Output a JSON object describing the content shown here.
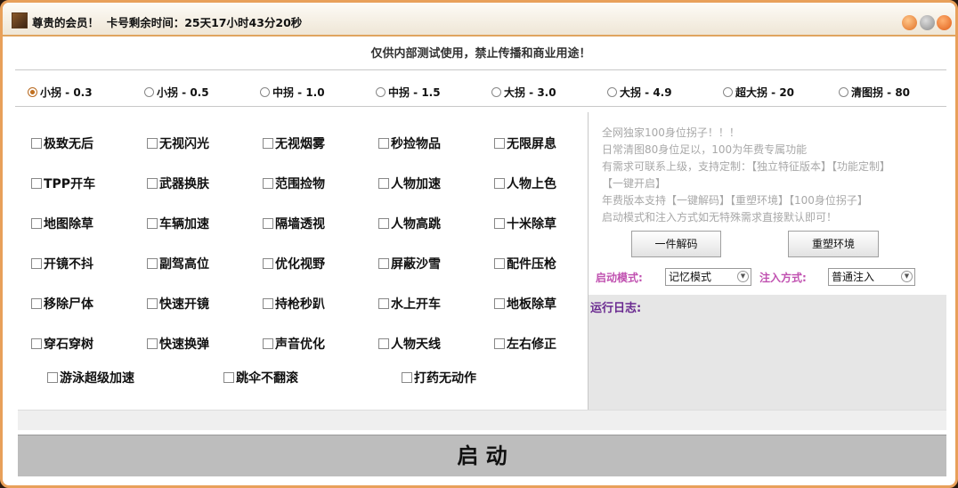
{
  "title": "尊贵的会员！  卡号剩余时间：25天17小时43分20秒",
  "notice": "仅供内部测试使用，禁止传播和商业用途！",
  "modes": [
    {
      "label": "小拐 - 0.3",
      "selected": true
    },
    {
      "label": "小拐 - 0.5",
      "selected": false
    },
    {
      "label": "中拐 - 1.0",
      "selected": false
    },
    {
      "label": "中拐 - 1.5",
      "selected": false
    },
    {
      "label": "大拐 - 3.0",
      "selected": false
    },
    {
      "label": "大拐 - 4.9",
      "selected": false
    },
    {
      "label": "超大拐 - 20",
      "selected": false
    },
    {
      "label": "清图拐 - 80",
      "selected": false
    }
  ],
  "features": [
    [
      "极致无后",
      "无视闪光",
      "无视烟雾",
      "秒捡物品",
      "无限屏息"
    ],
    [
      "TPP开车",
      "武器换肤",
      "范围捡物",
      "人物加速",
      "人物上色"
    ],
    [
      "地图除草",
      "车辆加速",
      "隔墙透视",
      "人物高跳",
      "十米除草"
    ],
    [
      "开镜不抖",
      "副驾高位",
      "优化视野",
      "屏蔽沙雪",
      "配件压枪"
    ],
    [
      "移除尸体",
      "快速开镜",
      "持枪秒趴",
      "水上开车",
      "地板除草"
    ],
    [
      "穿石穿树",
      "快速换弹",
      "声音优化",
      "人物天线",
      "左右修正"
    ]
  ],
  "features_last_row": [
    "游泳超级加速",
    "跳伞不翻滚",
    "打药无动作"
  ],
  "info": {
    "line1": "全网独家100身位拐子！！！",
    "line2": "日常清图80身位足以，100为年费专属功能",
    "line3": "有需求可联系上级，支持定制：【独立特征版本】【功能定制】",
    "line4": "【一键开启】",
    "line5": "年费版本支持【一键解码】【重塑环境】【100身位拐子】",
    "line6": "启动模式和注入方式如无特殊需求直接默认即可！"
  },
  "buttons": {
    "decode": "一件解码",
    "reshape": "重塑环境"
  },
  "startup_mode": {
    "label": "启动模式:",
    "value": "记忆模式"
  },
  "inject_mode": {
    "label": "注入方式:",
    "value": "普通注入"
  },
  "log_label": "运行日志:",
  "start_button": "启  动"
}
